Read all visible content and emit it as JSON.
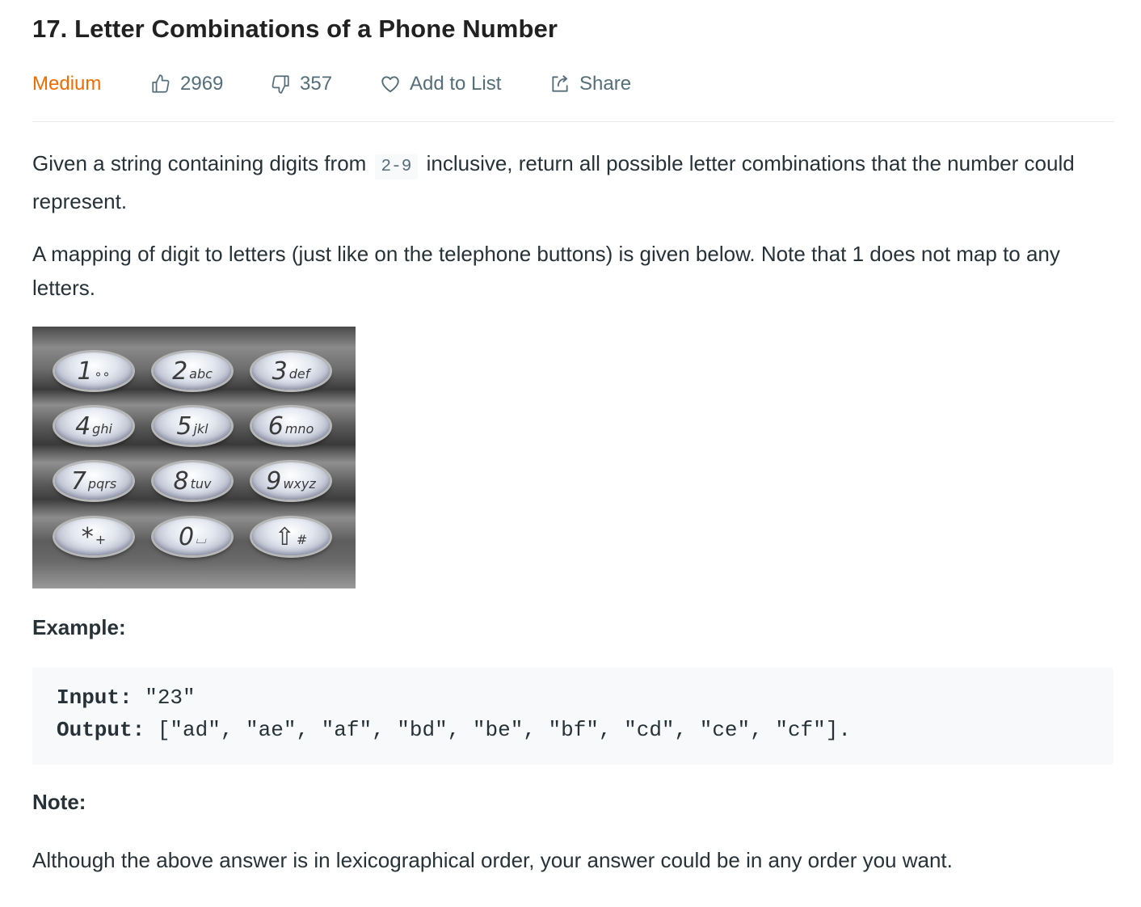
{
  "problem": {
    "title": "17. Letter Combinations of a Phone Number",
    "difficulty": "Medium",
    "likes": "2969",
    "dislikes": "357",
    "add_to_list_label": "Add to List",
    "share_label": "Share"
  },
  "description": {
    "p1_before": "Given a string containing digits from",
    "p1_code": "2-9",
    "p1_after": "inclusive, return all possible letter combinations that the number could represent.",
    "p2": "A mapping of digit to letters (just like on the telephone buttons) is given below. Note that 1 does not map to any letters."
  },
  "keypad": {
    "keys": [
      {
        "digit": "1",
        "letters": "∘∘"
      },
      {
        "digit": "2",
        "letters": "abc"
      },
      {
        "digit": "3",
        "letters": "def"
      },
      {
        "digit": "4",
        "letters": "ghi"
      },
      {
        "digit": "5",
        "letters": "jkl"
      },
      {
        "digit": "6",
        "letters": "mno"
      },
      {
        "digit": "7",
        "letters": "pqrs"
      },
      {
        "digit": "8",
        "letters": "tuv"
      },
      {
        "digit": "9",
        "letters": "wxyz"
      },
      {
        "digit": "*",
        "letters": "+"
      },
      {
        "digit": "0",
        "letters": "⌴"
      },
      {
        "digit": "⇧",
        "letters": "#"
      }
    ]
  },
  "example": {
    "heading": "Example:",
    "input_label": "Input:",
    "input_value": " \"23\"",
    "output_label": "Output:",
    "output_value": " [\"ad\", \"ae\", \"af\", \"bd\", \"be\", \"bf\", \"cd\", \"ce\", \"cf\"]."
  },
  "note": {
    "heading": "Note:",
    "text": "Although the above answer is in lexicographical order, your answer could be in any order you want."
  },
  "colors": {
    "difficulty_medium": "#ef6c00",
    "meta_text": "#546e7a",
    "body_text": "#263238",
    "code_bg": "#f7f9fa"
  }
}
